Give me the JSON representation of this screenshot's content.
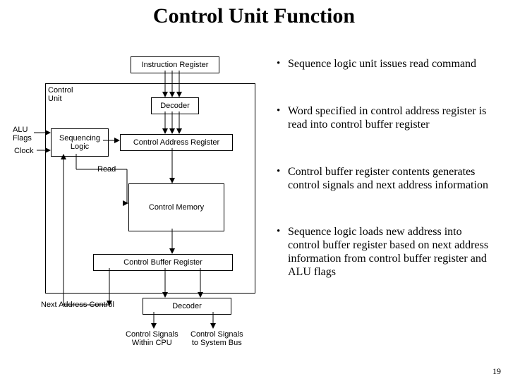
{
  "title": "Control Unit Function",
  "page_number": "19",
  "bullets": [
    "Sequence logic unit issues read command",
    "Word specified in control address register is read into control buffer register",
    "Control buffer register contents generates control signals and next address information",
    "Sequence logic loads new address into control buffer register based on next address information from control buffer register and ALU flags"
  ],
  "diagram": {
    "instruction_register": "Instruction Register",
    "control_unit": "Control\nUnit",
    "decoder_top": "Decoder",
    "alu_flags": "ALU\nFlags",
    "clock": "Clock",
    "sequencing_logic": "Sequencing\nLogic",
    "control_address_register": "Control Address Register",
    "read": "Read",
    "control_memory": "Control\nMemory",
    "control_buffer_register": "Control Buffer Register",
    "next_address_control": "Next Address Control",
    "decoder_bottom": "Decoder",
    "signals_cpu": "Control Signals\nWithin CPU",
    "signals_bus": "Control Signals\nto System Bus"
  }
}
